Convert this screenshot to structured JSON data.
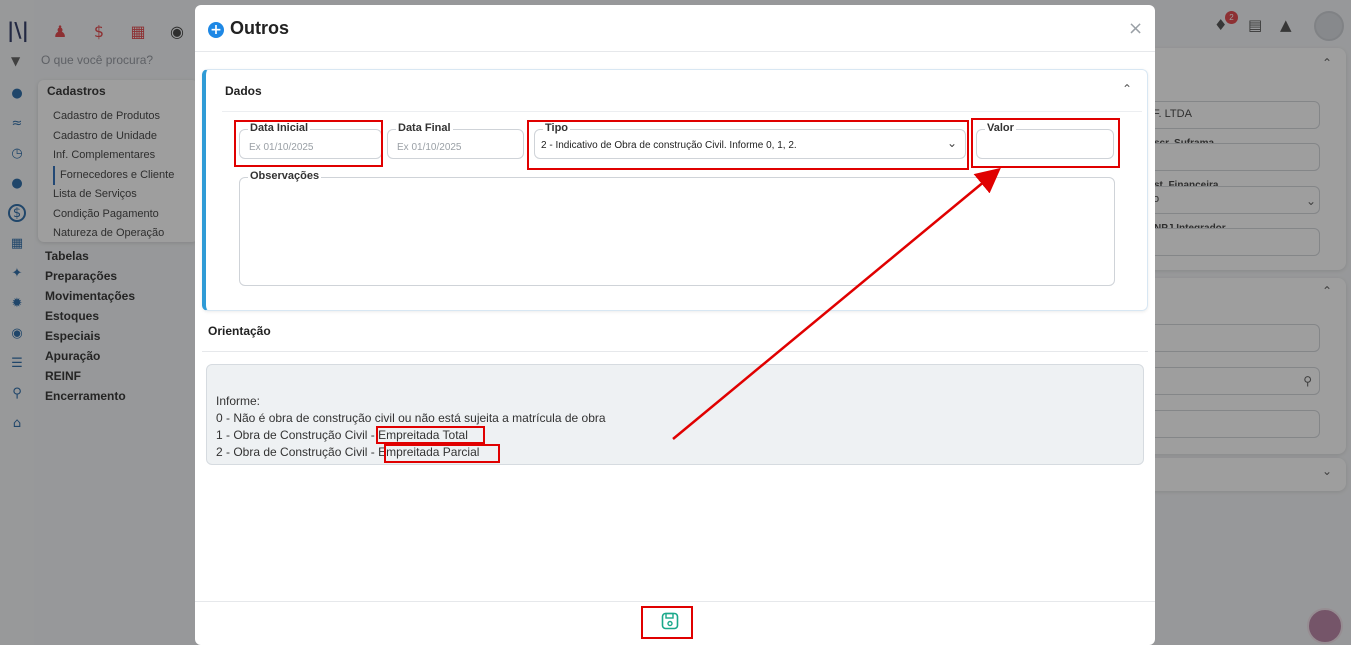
{
  "app": {
    "search_placeholder": "O que você procura?",
    "top_icons": [
      "users-icon",
      "dollar-icon",
      "grid-icon",
      "money-bag-icon"
    ],
    "notification_count": "2"
  },
  "sidebar_menu": {
    "title": "Cadastros",
    "items": [
      {
        "label": "Cadastro de Produtos",
        "active": false
      },
      {
        "label": "Cadastro de Unidade",
        "active": false
      },
      {
        "label": "Inf. Complementares",
        "active": false
      },
      {
        "label": "Fornecedores e Cliente",
        "active": true
      },
      {
        "label": "Lista de Serviços",
        "active": false
      },
      {
        "label": "Condição Pagamento",
        "active": false
      },
      {
        "label": "Natureza de Operação",
        "active": false
      }
    ],
    "categories": [
      "Tabelas",
      "Preparações",
      "Movimentações",
      "Estoques",
      "Especiais",
      "Apuração",
      "REINF",
      "Encerramento"
    ]
  },
  "right_panel": {
    "company_value": "F. LTDA",
    "label_suframa": "scr. Suframa",
    "label_financeira": "st. Financeira",
    "financeira_value": "o",
    "label_integrador": "NPJ Integrador"
  },
  "modal": {
    "title": "Outros",
    "close_symbol": "×",
    "section_dados": "Dados",
    "fields": {
      "data_inicial": {
        "label": "Data Inicial",
        "placeholder": "Ex 01/10/2025",
        "value": ""
      },
      "data_final": {
        "label": "Data Final",
        "placeholder": "Ex 01/10/2025",
        "value": ""
      },
      "tipo": {
        "label": "Tipo",
        "value": "2 - Indicativo de Obra de construção Civil. Informe 0, 1, 2."
      },
      "valor": {
        "label": "Valor",
        "value": ""
      },
      "observacoes": {
        "label": "Observações",
        "value": ""
      }
    },
    "section_orientacao": "Orientação",
    "orientacao": {
      "line0": "Informe:",
      "line1": "0 - Não é obra de construção civil ou não está sujeita a matrícula de obra",
      "line2_prefix": "1 - Obra de Construção Civil - ",
      "line2_highlight": "Empreitada Total",
      "line3_prefix": "2 - Obra de Construção Civil - ",
      "line3_highlight": "Empreitada Parcial"
    },
    "save_icon": "save-icon"
  },
  "annotation_colors": {
    "highlight": "#e00000",
    "accent": "#2f9bd6",
    "save": "#1aa88a"
  }
}
